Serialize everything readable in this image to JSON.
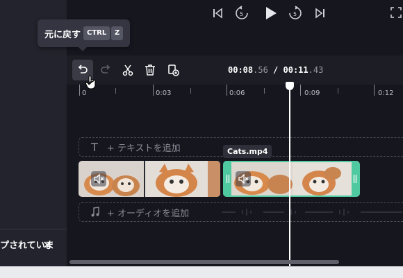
{
  "tooltip": {
    "label": "元に戻す",
    "key1": "CTRL",
    "key2": "Z"
  },
  "timecode": {
    "current_main": "00:08",
    "current_frac": ".56",
    "separator": " / ",
    "total_main": "00:11",
    "total_frac": ".43"
  },
  "ruler": {
    "labels": [
      "0",
      "0:03",
      "0:06",
      "0:09",
      "0:12"
    ]
  },
  "tracks": {
    "text_add": "+ テキストを追加",
    "audio_add": "+ オーディオを追加"
  },
  "clip": {
    "selected_name": "Cats.mp4"
  },
  "left_panel": {
    "truncated_text": "プされていま"
  },
  "colors": {
    "accent_green": "#4fc9a0",
    "background": "#16161f",
    "tooltip_bg": "#343540"
  },
  "icons": [
    "skip-back-icon",
    "rewind-5-icon",
    "play-icon",
    "forward-5-icon",
    "skip-forward-icon",
    "fullscreen-icon",
    "undo-icon",
    "redo-icon",
    "scissors-icon",
    "trash-icon",
    "duplicate-icon",
    "text-icon",
    "music-note-icon",
    "mute-icon",
    "trim-handle-icon",
    "hand-cursor-icon"
  ]
}
